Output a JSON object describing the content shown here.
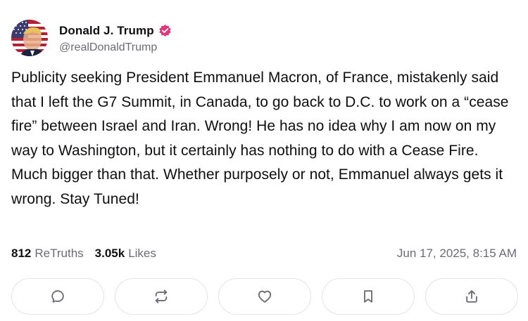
{
  "author": {
    "display_name": "Donald J. Trump",
    "handle": "@realDonaldTrump",
    "verified": true,
    "verified_color": "#e6337a"
  },
  "post": {
    "text": "Publicity seeking President Emmanuel Macron, of France, mistakenly said that I left the G7 Summit, in Canada, to go back to D.C. to work on a “cease fire” between Israel and Iran. Wrong! He has no idea why I am now on my way to Washington, but it certainly has nothing to do with a Cease Fire. Much bigger than that. Whether purposely or not, Emmanuel always gets it wrong. Stay Tuned!"
  },
  "stats": {
    "retruths_count": "812",
    "retruths_label": "ReTruths",
    "likes_count": "3.05k",
    "likes_label": "Likes",
    "timestamp": "Jun 17, 2025, 8:15 AM"
  },
  "actions": [
    {
      "icon": "reply-icon"
    },
    {
      "icon": "retruth-icon"
    },
    {
      "icon": "like-icon"
    },
    {
      "icon": "bookmark-icon"
    },
    {
      "icon": "share-icon"
    }
  ],
  "colors": {
    "text_primary": "#0f0f12",
    "text_secondary": "#6b6b76",
    "border": "#e3e3e8",
    "background": "#ffffff"
  }
}
